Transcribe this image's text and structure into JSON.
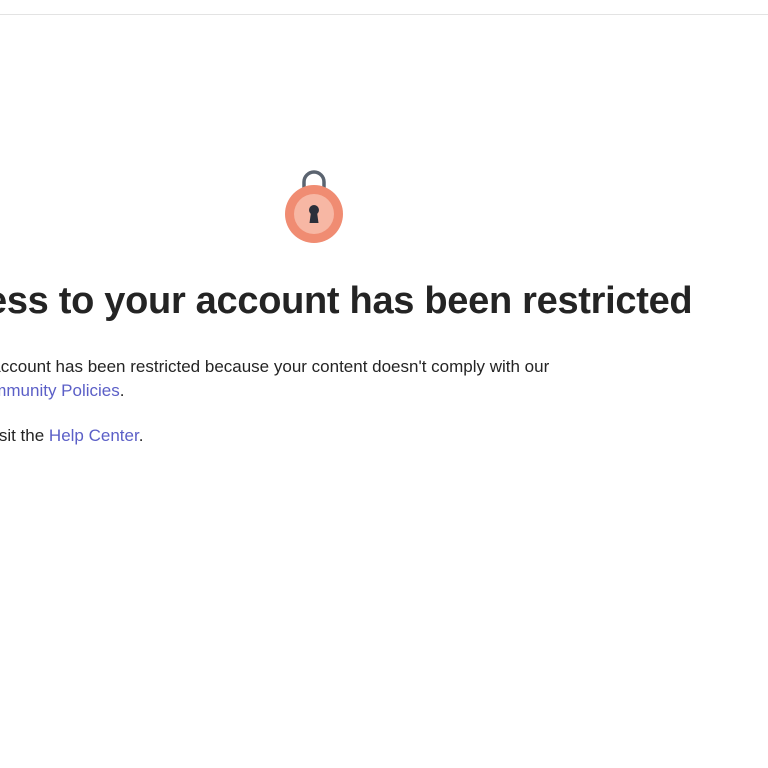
{
  "page": {
    "headline": "ess to your account has been restricted",
    "message": {
      "line1": "our account has been restricted because your content doesn't comply with our",
      "policies_link": "l Community Policies",
      "policies_suffix": ".",
      "help_prefix": "re, visit the ",
      "help_link": "Help Center",
      "help_suffix": "."
    }
  },
  "icons": {
    "lock": "lock-icon"
  },
  "colors": {
    "link": "#5b5fc7",
    "lock_outer": "#f08c72",
    "lock_inner": "#f7b7a4",
    "lock_shackle": "#5b6470",
    "keyhole": "#2b2f3a",
    "text": "#242424"
  }
}
